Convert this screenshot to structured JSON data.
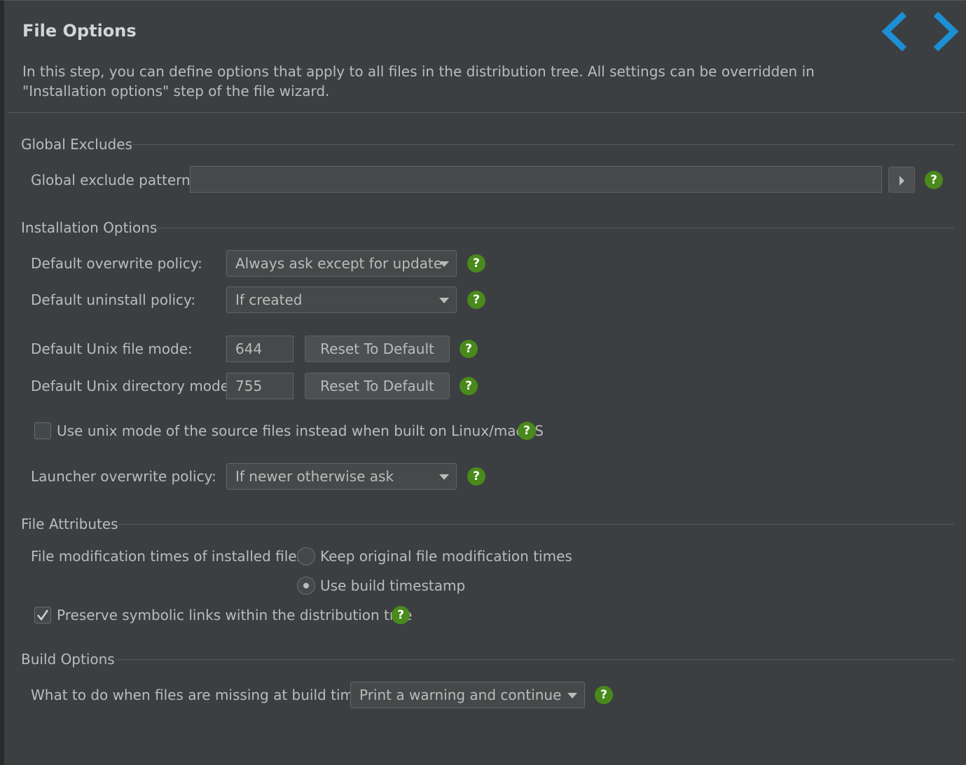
{
  "header": {
    "title": "File Options",
    "description": "In this step, you can define options that apply to all files in the distribution tree. All settings can be overridden in \"Installation options\" step of the file wizard."
  },
  "icons": {
    "back": "chevron-left-icon",
    "forward": "chevron-right-icon",
    "help": "help-icon",
    "help_glyph": "?"
  },
  "colors": {
    "accent": "#1d8fd4",
    "help_badge": "#4a8a1c",
    "background": "#3c3f41"
  },
  "global_excludes": {
    "section_title": "Global Excludes",
    "pattern_label": "Global exclude pattern:",
    "pattern_value": ""
  },
  "installation_options": {
    "section_title": "Installation Options",
    "overwrite_label": "Default overwrite policy:",
    "overwrite_value": "Always ask except for update",
    "uninstall_label": "Default uninstall policy:",
    "uninstall_value": "If created",
    "file_mode_label": "Default Unix file mode:",
    "file_mode_value": "644",
    "dir_mode_label": "Default Unix directory mode:",
    "dir_mode_value": "755",
    "reset_label": "Reset To Default",
    "use_unix_mode_label": "Use unix mode of the source files instead when built on Linux/macOS",
    "use_unix_mode_checked": false,
    "launcher_label": "Launcher overwrite policy:",
    "launcher_value": "If newer otherwise ask"
  },
  "file_attributes": {
    "section_title": "File Attributes",
    "mod_times_label": "File modification times of installed files:",
    "option_keep": "Keep original file modification times",
    "option_build": "Use build timestamp",
    "selected": "Use build timestamp",
    "preserve_links_label": "Preserve symbolic links within the distribution tree",
    "preserve_links_checked": true
  },
  "build_options": {
    "section_title": "Build Options",
    "missing_label": "What to do when files are missing at build time:",
    "missing_value": "Print a warning and continue"
  }
}
